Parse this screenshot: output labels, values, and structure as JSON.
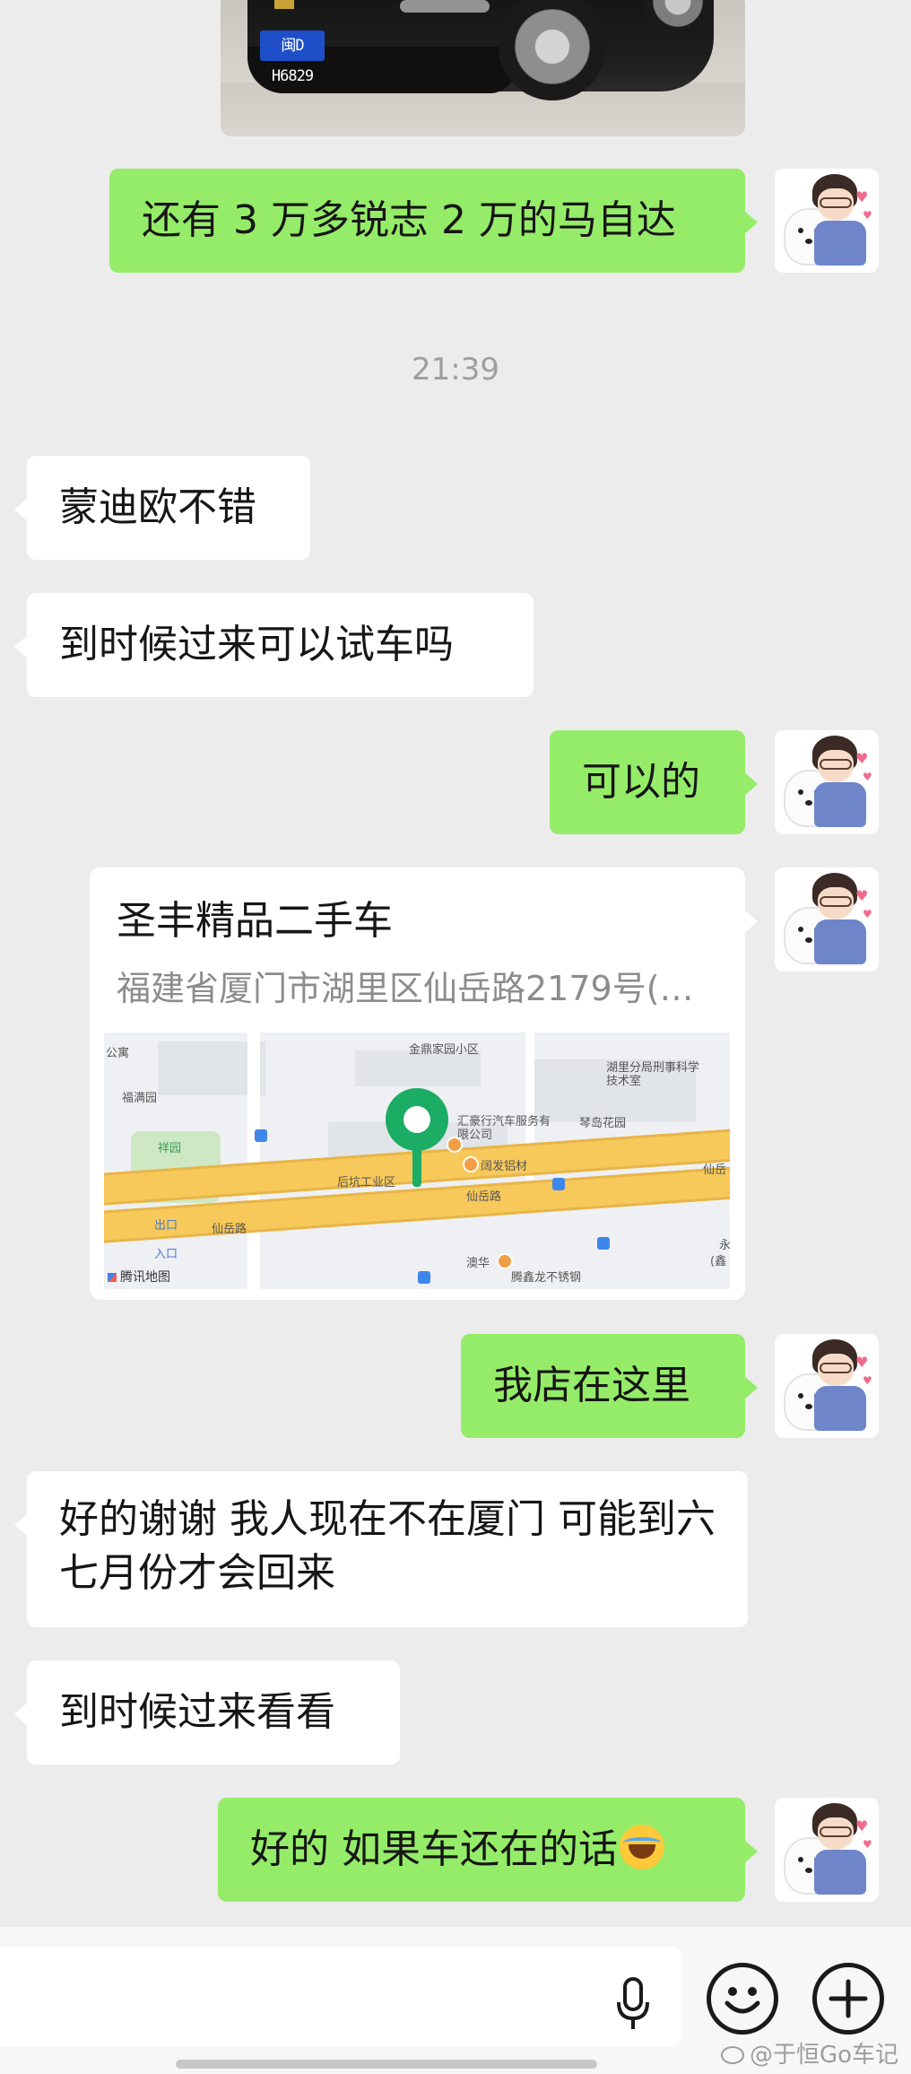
{
  "photo": {
    "plate_text": "闽D H6829"
  },
  "time_separator": "21:39",
  "messages": [
    {
      "side": "right",
      "text": "还有 3 万多锐志 2 万的马自达"
    },
    {
      "side": "left",
      "text": "蒙迪欧不错"
    },
    {
      "side": "left",
      "text": "到时候过来可以试车吗"
    },
    {
      "side": "right",
      "text": "可以的"
    },
    {
      "side": "right",
      "text": "我店在这里"
    },
    {
      "side": "left",
      "text": "好的谢谢 我人现在不在厦门 可能到六七月份才会回来"
    },
    {
      "side": "left",
      "text": "到时候过来看看"
    },
    {
      "side": "right",
      "text": "好的 如果车还在的话"
    }
  ],
  "location": {
    "name": "圣丰精品二手车",
    "address": "福建省厦门市湖里区仙岳路2179号(…",
    "map": {
      "brand": "腾讯地图",
      "labels": {
        "area1": "金鼎家园小区",
        "area2": "福满园",
        "area3": "祥园",
        "area4": "后坑工业区",
        "area5": "琴岛花园",
        "area6": "澳华",
        "area7": "湖里分局刑事科学技术室",
        "poi1": "汇豪行汽车服务有限公司",
        "poi2": "阔发铝材",
        "poi3": "腾鑫龙不锈钢",
        "road1": "仙岳路",
        "road2": "仙岳路",
        "road3": "仙岳",
        "apt": "公寓",
        "exit1": "出口",
        "exit2": "入口",
        "edge1": "永",
        "edge2": "(鑫"
      }
    }
  },
  "input_bar": {
    "placeholder": "",
    "icons": [
      "microphone-icon",
      "emoji-icon",
      "plus-icon"
    ]
  },
  "watermark": "@于恒Go车记",
  "colors": {
    "background": "#ececec",
    "bubble_right": "#95ec69",
    "bubble_left": "#ffffff",
    "map_pin": "#1aad63"
  }
}
